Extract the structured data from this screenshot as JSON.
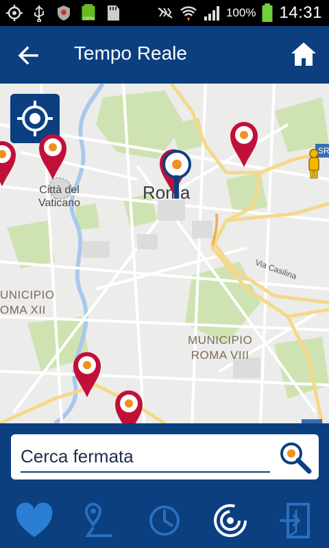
{
  "status_bar": {
    "battery_percent": "100%",
    "time": "14:31",
    "battery_small_label": "100%",
    "icons": [
      "gps-icon",
      "usb-icon",
      "shield-icon",
      "battery-icon",
      "sd-card-icon",
      "mute-icon",
      "wifi-icon",
      "signal-icon",
      "battery-full-icon"
    ]
  },
  "app_bar": {
    "title": "Tempo Reale",
    "back_icon": "arrow-left-icon",
    "home_icon": "home-icon"
  },
  "map": {
    "labels": {
      "vatican": "Città del\nVaticano",
      "city": "Roma",
      "municipio_xii": "UNICIPIO\nOMA XII",
      "municipio_viii": "MUNICIPIO\nROMA VIII",
      "road_casilina": "Via Casilina",
      "sr_tag": "SR"
    },
    "locate_icon": "crosshair-icon",
    "marker_color": "#c0103a",
    "marker_dot_color": "#f09020",
    "selected_marker_color": "#0b3f80"
  },
  "search": {
    "value": "Cerca fermata",
    "icon": "search-icon"
  },
  "tabs": [
    {
      "name": "favorites",
      "icon": "heart-icon",
      "active": true
    },
    {
      "name": "route",
      "icon": "route-pin-icon",
      "active": false
    },
    {
      "name": "time",
      "icon": "clock-icon",
      "active": false
    },
    {
      "name": "realtime",
      "icon": "radar-icon",
      "active": true
    },
    {
      "name": "exit",
      "icon": "exit-door-icon",
      "active": false
    }
  ],
  "colors": {
    "primary": "#0b3f80",
    "accent_light": "#2a6fc0",
    "white": "#ffffff"
  }
}
